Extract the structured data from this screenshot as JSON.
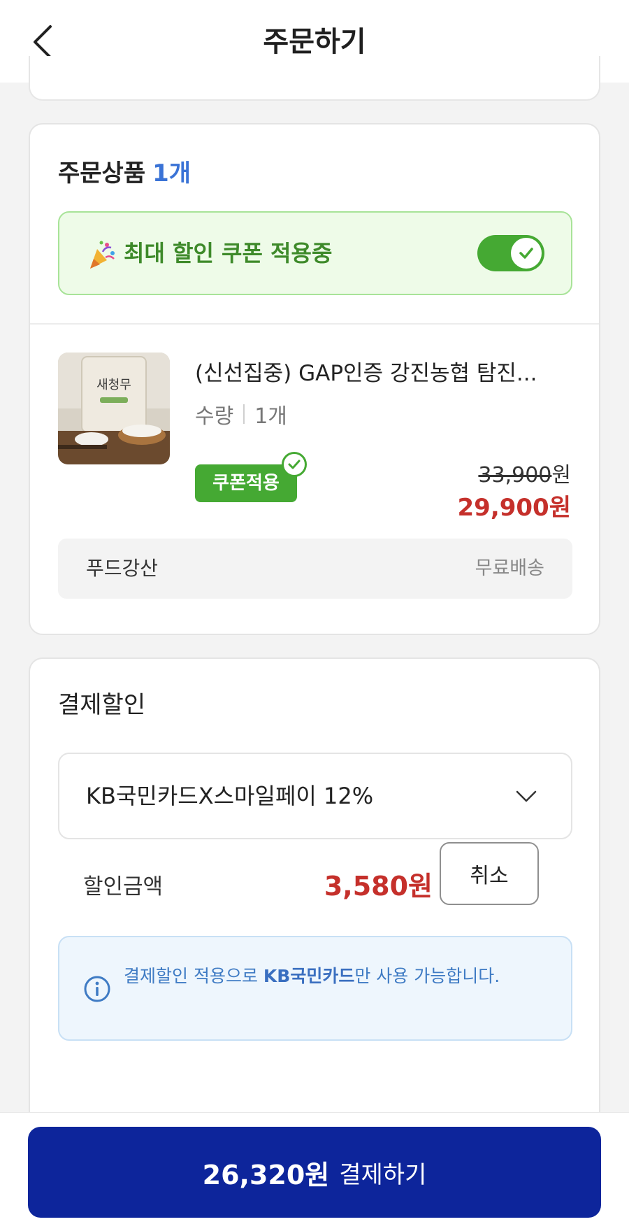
{
  "header": {
    "title": "주문하기"
  },
  "order_items": {
    "title": "주문상품",
    "count": "1개",
    "coupon_banner": {
      "text": "최대 할인 쿠폰 적용중",
      "toggle_on": true
    },
    "product": {
      "name": "(신선집중) GAP인증 강진농협 탐진...",
      "qty_label": "수량",
      "qty_value": "1개",
      "coupon_badge": "쿠폰적용",
      "original_price": "33,900",
      "original_unit": "원",
      "sale_price": "29,900원"
    },
    "seller": {
      "name": "푸드강산",
      "shipping": "무료배송"
    }
  },
  "payment_discount": {
    "title": "결제할인",
    "selected_option": "KB국민카드X스마일페이 12%",
    "amount_label": "할인금액",
    "amount_value": "3,580원",
    "cancel_label": "취소",
    "notice_prefix": "결제할인 적용으로 ",
    "notice_highlight": "KB국민카드",
    "notice_suffix": "만 사용 가능합니다."
  },
  "checkout": {
    "amount": "26,320원",
    "label": "결제하기"
  },
  "colors": {
    "accent_blue": "#3a73d6",
    "coupon_green": "#45a933",
    "sale_red": "#c5302b",
    "pay_button": "#0d259b"
  },
  "icons": {
    "back": "chevron-left-icon",
    "party": "party-popper-icon",
    "toggle": "check-icon",
    "dropdown": "chevron-down-icon",
    "info": "info-circle-icon"
  }
}
